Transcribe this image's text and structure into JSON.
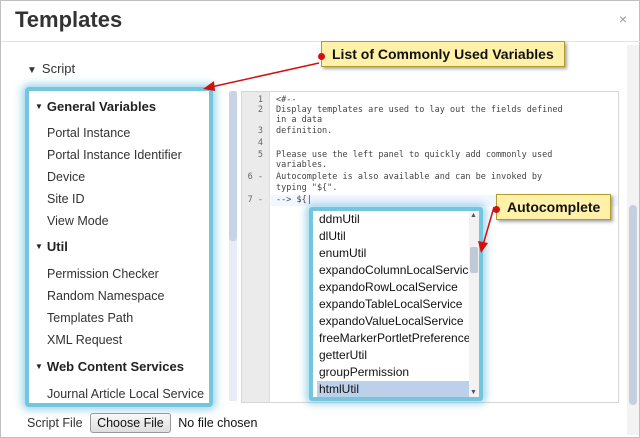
{
  "dialog": {
    "title": "Templates",
    "close_label": "×"
  },
  "section": {
    "label": "Script"
  },
  "variables": {
    "groups": [
      {
        "label": "General Variables",
        "items": [
          "Portal Instance",
          "Portal Instance Identifier",
          "Device",
          "Site ID",
          "View Mode"
        ]
      },
      {
        "label": "Util",
        "items": [
          "Permission Checker",
          "Random Namespace",
          "Templates Path",
          "XML Request"
        ]
      },
      {
        "label": "Web Content Services",
        "items": [
          "Journal Article Local Service"
        ]
      }
    ]
  },
  "editor": {
    "lines": [
      {
        "n": "1",
        "text": "<#--"
      },
      {
        "n": "2",
        "text": "Display templates are used to lay out the fields defined"
      },
      {
        "n": "",
        "text": "in a data"
      },
      {
        "n": "3",
        "text": "definition."
      },
      {
        "n": "4",
        "text": ""
      },
      {
        "n": "5",
        "text": "Please use the left panel to quickly add commonly used"
      },
      {
        "n": "",
        "text": "variables."
      },
      {
        "n": "6 -",
        "text": "Autocomplete is also available and can be invoked by"
      },
      {
        "n": "",
        "text": "typing \"${\"."
      },
      {
        "n": "7 -",
        "text": "--> ${|"
      }
    ]
  },
  "autocomplete": {
    "items": [
      "ddmUtil",
      "dlUtil",
      "enumUtil",
      "expandoColumnLocalService",
      "expandoRowLocalService",
      "expandoTableLocalService",
      "expandoValueLocalService",
      "freeMarkerPortletPreferences",
      "getterUtil",
      "groupPermission",
      "htmlUtil"
    ],
    "selected_index": 10
  },
  "callouts": {
    "variables": "List of Commonly Used Variables",
    "autocomplete": "Autocomplete"
  },
  "file": {
    "label": "Script File",
    "button": "Choose File",
    "status": "No file chosen"
  },
  "colors": {
    "highlight": "#74c6de",
    "callout_bg": "#fff2a8",
    "arrow": "#d21010"
  }
}
